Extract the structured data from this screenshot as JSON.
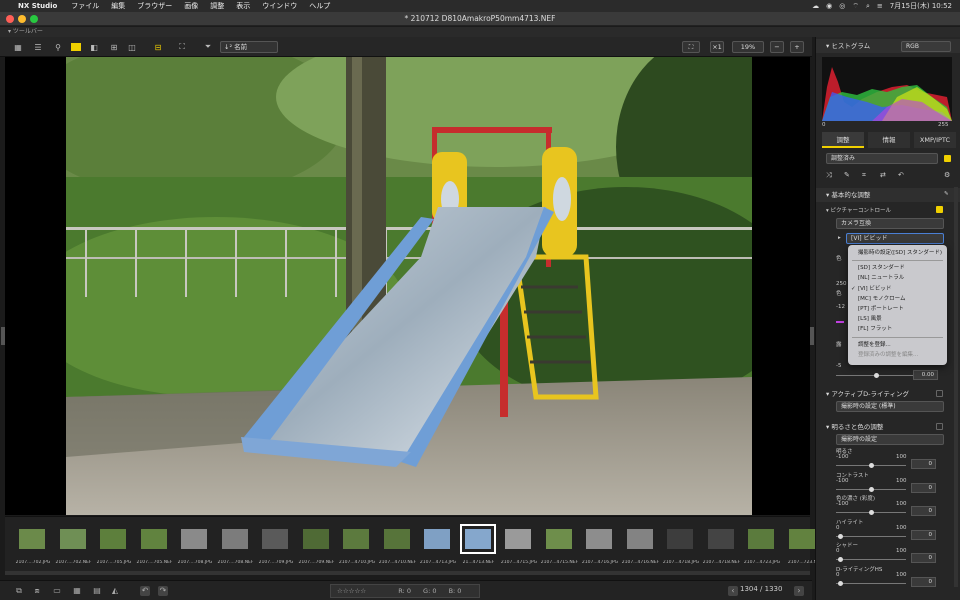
{
  "menubar": {
    "app_name": "NX Studio",
    "items": [
      "ファイル",
      "編集",
      "ブラウザー",
      "画像",
      "調整",
      "表示",
      "ウインドウ",
      "ヘルプ"
    ],
    "clock": "7月15日(木) 10:52"
  },
  "window": {
    "title": "* 210712 D810AmakroP50mm4713.NEF",
    "toolbar_section": "ツールバー"
  },
  "toolbar": {
    "sort_label": "↓² 名前",
    "zoom_fit": "×1",
    "zoom_level": "19%"
  },
  "filmstrip": [
    {
      "label": "2107....702.JPG",
      "color": "#6b8a4a"
    },
    {
      "label": "2107....702.NEF",
      "color": "#6f8f55"
    },
    {
      "label": "2107....705.JPG",
      "color": "#5d7f3c"
    },
    {
      "label": "2107....705.NEF",
      "color": "#61833f"
    },
    {
      "label": "2107....708.JPG",
      "color": "#8a8a8a"
    },
    {
      "label": "2107....708.NEF",
      "color": "#7c7c7c"
    },
    {
      "label": "2107....709.JPG",
      "color": "#5a5a5a"
    },
    {
      "label": "2107....709.NEF",
      "color": "#4f6a35"
    },
    {
      "label": "2107...4710.JPG",
      "color": "#5c7a3e"
    },
    {
      "label": "2107...4710.NEF",
      "color": "#57743a"
    },
    {
      "label": "2107...4713.JPG",
      "color": "#7fa0c4"
    },
    {
      "label": "21...4713.NEF",
      "color": "#85a7cc"
    },
    {
      "label": "2107...4715.JPG",
      "color": "#9a9a9a"
    },
    {
      "label": "2107...4715.NEF",
      "color": "#6e8e4b"
    },
    {
      "label": "2107...4716.JPG",
      "color": "#8d8d8d"
    },
    {
      "label": "2107...4716.NEF",
      "color": "#838383"
    },
    {
      "label": "2107...4718.JPG",
      "color": "#3d3d3d"
    },
    {
      "label": "2107...4718.NEF",
      "color": "#444444"
    },
    {
      "label": "2107...4723.JPG",
      "color": "#5b7b3d"
    },
    {
      "label": "2107...723.N",
      "color": "#62823f"
    }
  ],
  "bottombar": {
    "rating_stars": "☆☆☆☆☆",
    "r_label": "R:",
    "r_value": "0",
    "g_label": "G:",
    "g_value": "0",
    "b_label": "B:",
    "b_value": "0",
    "counter": "1304 / 1330"
  },
  "sidebar": {
    "histogram_title": "ヒストグラム",
    "histogram_mode": "RGB",
    "hist_min": "0",
    "hist_max": "255",
    "tabs": [
      "調整",
      "情報",
      "XMP/IPTC"
    ],
    "preset": "調整済み",
    "basic_section": "基本的な調整",
    "picture_control_label": "ピクチャーコントロール",
    "picture_control_mode": "カメラ互換",
    "picture_control_value": "[VI] ビビッド",
    "hidden_fragments": [
      "色",
      "250",
      "色",
      "-12",
      "露",
      "-5"
    ],
    "exposure_value": "0.00",
    "active_d_label": "アクティブD-ライティング",
    "active_d_value": "撮影時の設定 (標準)",
    "brightness_section": "明るさと色の調整",
    "brightness_mode": "撮影時の設定",
    "sliders": [
      {
        "label": "明るさ",
        "min": "-100",
        "max": "100",
        "value": "0"
      },
      {
        "label": "コントラスト",
        "min": "-100",
        "max": "100",
        "value": "0"
      },
      {
        "label": "色の濃さ (彩度)",
        "min": "-100",
        "max": "100",
        "value": "0"
      },
      {
        "label": "ハイライト",
        "min": "0",
        "max": "100",
        "value": "0"
      },
      {
        "label": "シャドー",
        "min": "0",
        "max": "100",
        "value": "0"
      },
      {
        "label": "D-ライティングHS",
        "min": "0",
        "max": "100",
        "value": "0"
      }
    ]
  },
  "dropdown": {
    "items": [
      "撮影時の設定([SD] スタンダード)",
      "[SD] スタンダード",
      "[NL] ニュートラル",
      "[VI] ビビッド",
      "[MC] モノクローム",
      "[PT] ポートレート",
      "[LS] 風景",
      "[FL] フラット"
    ],
    "checked_index": 3,
    "register": "調整を登録...",
    "edit_registered": "登録済みの調整を編集..."
  }
}
